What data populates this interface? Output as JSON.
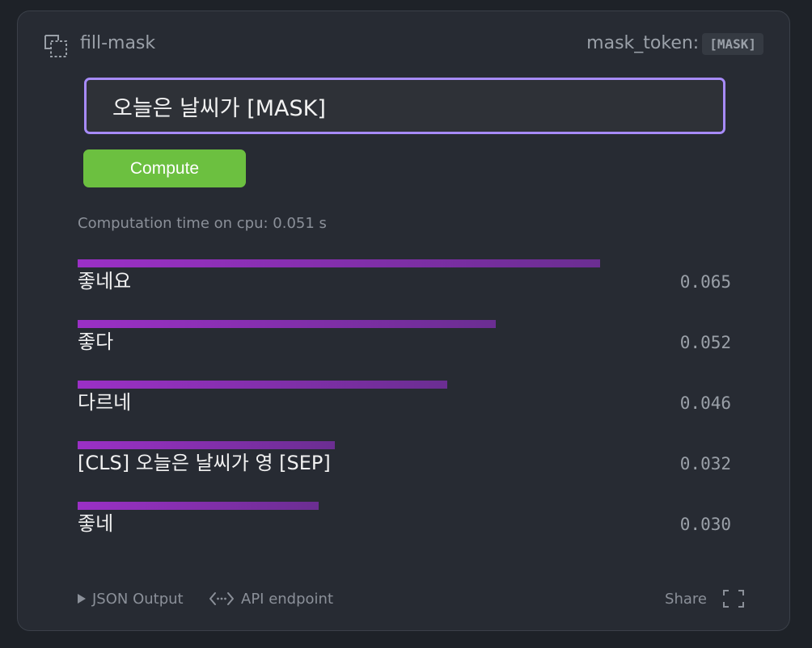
{
  "header": {
    "task_name": "fill-mask",
    "mask_label": "mask_token:",
    "mask_token": "[MASK]",
    "icon": "fill-mask-icon"
  },
  "input": {
    "value": "오늘은 날씨가 [MASK]"
  },
  "compute_button": {
    "label": "Compute",
    "color": "#6cc040"
  },
  "computation_time": "Computation time on cpu: 0.051 s",
  "results": [
    {
      "label": "좋네요",
      "score": "0.065",
      "value": 0.065
    },
    {
      "label": "좋다",
      "score": "0.052",
      "value": 0.052
    },
    {
      "label": "다르네",
      "score": "0.046",
      "value": 0.046
    },
    {
      "label": "[CLS] 오늘은 날씨가 영 [SEP]",
      "score": "0.032",
      "value": 0.032
    },
    {
      "label": "좋네",
      "score": "0.030",
      "value": 0.03
    }
  ],
  "footer": {
    "json_output": "JSON Output",
    "api_endpoint": "API endpoint",
    "share": "Share"
  },
  "colors": {
    "accent_border": "#a78bfa",
    "bar_start": "#9b30c6",
    "bar_end": "#6b2e92"
  }
}
